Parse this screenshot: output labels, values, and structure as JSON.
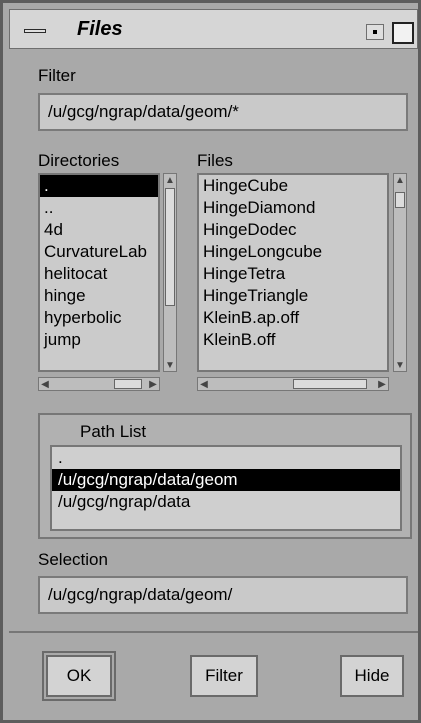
{
  "window": {
    "title": "Files"
  },
  "filter": {
    "label": "Filter",
    "value": "/u/gcg/ngrap/data/geom/*"
  },
  "directories": {
    "label": "Directories",
    "items": [
      ".",
      "..",
      "4d",
      "CurvatureLab",
      "helitocat",
      "hinge",
      "hyperbolic",
      "jump"
    ],
    "selected_index": 0
  },
  "files": {
    "label": "Files",
    "items": [
      "HingeCube",
      "HingeDiamond",
      "HingeDodec",
      "HingeLongcube",
      "HingeTetra",
      "HingeTriangle",
      "KleinB.ap.off",
      "KleinB.off"
    ]
  },
  "path_list": {
    "label": "Path List",
    "items": [
      ".",
      "/u/gcg/ngrap/data/geom",
      "/u/gcg/ngrap/data"
    ],
    "selected_index": 1
  },
  "selection": {
    "label": "Selection",
    "value": "/u/gcg/ngrap/data/geom/"
  },
  "buttons": {
    "ok": "OK",
    "filter": "Filter",
    "hide": "Hide"
  }
}
